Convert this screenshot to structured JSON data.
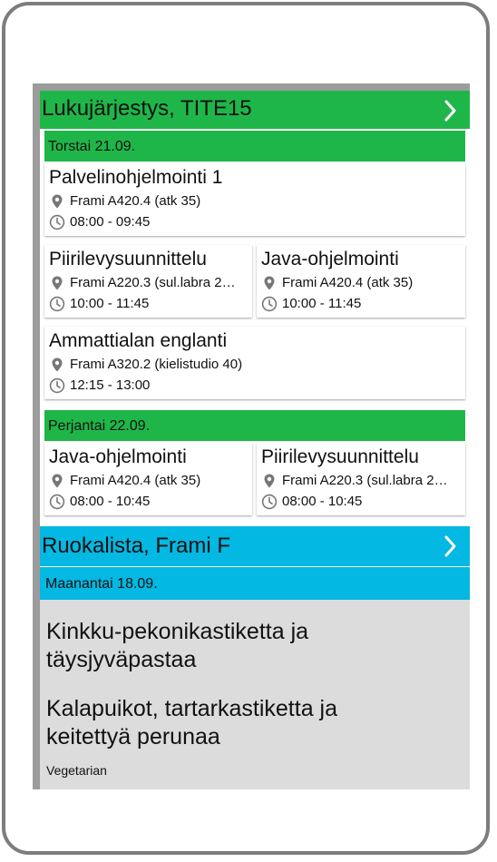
{
  "schedule": {
    "title": "Lukujärjestys, TITE15",
    "days": [
      {
        "label": "Torstai 21.09.",
        "courses": [
          {
            "name": "Palvelinohjelmointi 1",
            "room": "Frami A420.4 (atk 35)",
            "time": "08:00 - 09:45"
          },
          {
            "name": "Piirilevysuunnittelu",
            "room": "Frami A220.3 (sul.labra 2…",
            "time": "10:00 - 11:45"
          },
          {
            "name": "Java-ohjelmointi",
            "room": "Frami A420.4 (atk 35)",
            "time": "10:00 - 11:45"
          },
          {
            "name": "Ammattialan englanti",
            "room": "Frami A320.2 (kielistudio 40)",
            "time": "12:15 - 13:00"
          }
        ]
      },
      {
        "label": "Perjantai 22.09.",
        "courses": [
          {
            "name": "Java-ohjelmointi",
            "room": "Frami A420.4 (atk 35)",
            "time": "08:00 - 10:45"
          },
          {
            "name": "Piirilevysuunnittelu",
            "room": "Frami A220.3 (sul.labra 2…",
            "time": "08:00 - 10:45"
          }
        ]
      }
    ]
  },
  "menu": {
    "title": "Ruokalista, Frami F",
    "day": "Maanantai 18.09.",
    "dishes": [
      {
        "line1": "Kinkku-pekonikastiketta ja",
        "line2": "täysjyväpastaa"
      },
      {
        "line1": "Kalapuikot, tartarkastiketta ja",
        "line2": "keitettyä perunaa"
      }
    ],
    "vegetarian_label": "Vegetarian"
  },
  "icons": {
    "header_arrow": "chevron-right-icon",
    "room": "location-pin-icon",
    "time": "clock-icon"
  },
  "colors": {
    "schedule_accent": "#1fb649",
    "menu_accent": "#03b8e2",
    "menu_bg": "#dcdcdc"
  }
}
